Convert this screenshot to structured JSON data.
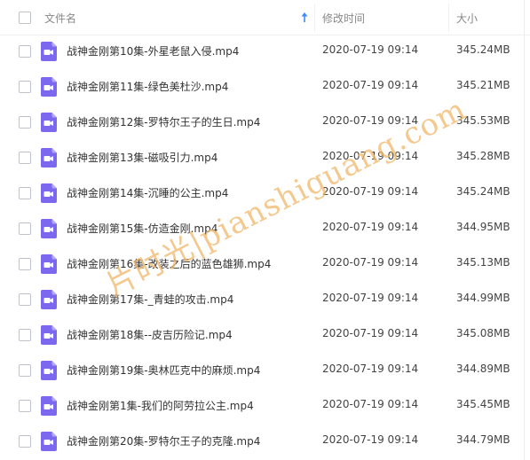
{
  "header": {
    "name_label": "文件名",
    "time_label": "修改时间",
    "size_label": "大小",
    "sort_icon": "sort-ascending-arrow-icon",
    "sort_color": "#3b8cff"
  },
  "icon_color": "#7b68ee",
  "files": [
    {
      "name": "战神金刚第10集-外星老鼠入侵.mp4",
      "time": "2020-07-19 09:14",
      "size": "345.24MB",
      "icon": "video-file-icon"
    },
    {
      "name": "战神金刚第11集-绿色美杜沙.mp4",
      "time": "2020-07-19 09:14",
      "size": "345.21MB",
      "icon": "video-file-icon"
    },
    {
      "name": "战神金刚第12集-罗特尔王子的生日.mp4",
      "time": "2020-07-19 09:14",
      "size": "345.53MB",
      "icon": "video-file-icon"
    },
    {
      "name": "战神金刚第13集-磁吸引力.mp4",
      "time": "2020-07-19 09:14",
      "size": "345.28MB",
      "icon": "video-file-icon"
    },
    {
      "name": "战神金刚第14集-沉睡的公主.mp4",
      "time": "2020-07-19 09:14",
      "size": "345.24MB",
      "icon": "video-file-icon"
    },
    {
      "name": "战神金刚第15集-仿造金刚.mp4",
      "time": "2020-07-19 09:14",
      "size": "344.95MB",
      "icon": "video-file-icon"
    },
    {
      "name": "战神金刚第16集-改装之后的蓝色雄狮.mp4",
      "time": "2020-07-19 09:14",
      "size": "345.13MB",
      "icon": "video-file-icon"
    },
    {
      "name": "战神金刚第17集-_青蛙的攻击.mp4",
      "time": "2020-07-19 09:14",
      "size": "344.99MB",
      "icon": "video-file-icon"
    },
    {
      "name": "战神金刚第18集--皮吉历险记.mp4",
      "time": "2020-07-19 09:14",
      "size": "345.08MB",
      "icon": "video-file-icon"
    },
    {
      "name": "战神金刚第19集-奥林匹克中的麻烦.mp4",
      "time": "2020-07-19 09:14",
      "size": "344.89MB",
      "icon": "video-file-icon"
    },
    {
      "name": "战神金刚第1集-我们的阿劳拉公主.mp4",
      "time": "2020-07-19 09:14",
      "size": "345.45MB",
      "icon": "video-file-icon"
    },
    {
      "name": "战神金刚第20集-罗特尔王子的克隆.mp4",
      "time": "2020-07-19 09:14",
      "size": "344.79MB",
      "icon": "video-file-icon"
    }
  ],
  "watermark": "片时光|pianshiguang.com"
}
